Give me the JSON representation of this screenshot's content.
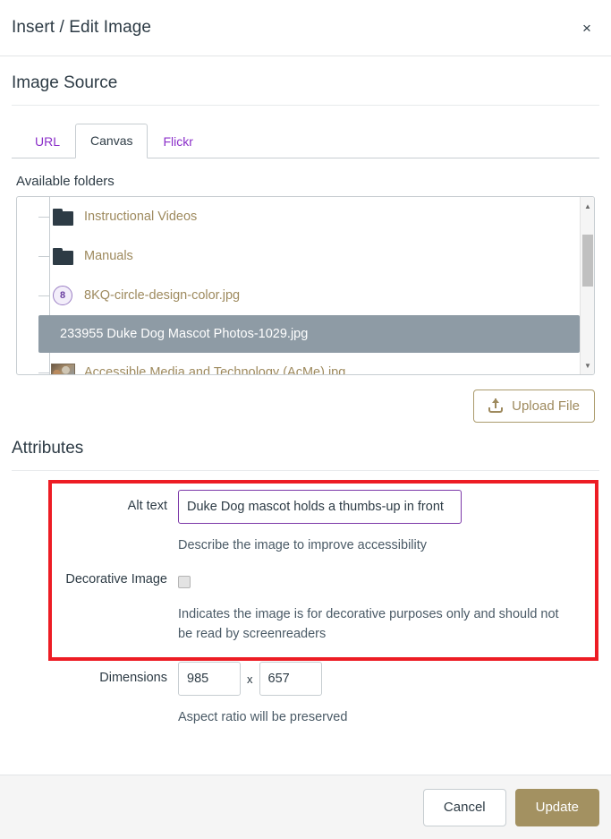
{
  "dialog": {
    "title": "Insert / Edit Image",
    "close_label": "×"
  },
  "image_source": {
    "heading": "Image Source",
    "tabs": [
      {
        "label": "URL",
        "active": false
      },
      {
        "label": "Canvas",
        "active": true
      },
      {
        "label": "Flickr",
        "active": false
      }
    ],
    "available_folders_label": "Available folders",
    "tree": [
      {
        "label": "Instructional Videos",
        "icon": "folder-icon",
        "selected": false
      },
      {
        "label": "Manuals",
        "icon": "folder-icon",
        "selected": false
      },
      {
        "label": "8KQ-circle-design-color.jpg",
        "icon": "circle-logo-thumbnail-icon",
        "selected": false
      },
      {
        "label": "233955 Duke Dog Mascot Photos-1029.jpg",
        "icon": "none",
        "selected": true
      },
      {
        "label": "Accessible Media and Technology (AcMe).jpg",
        "icon": "photo-thumbnail-icon",
        "selected": false
      }
    ],
    "upload_button_label": "Upload File",
    "upload_icon": "upload-arrow-icon"
  },
  "attributes": {
    "heading": "Attributes",
    "alt_text": {
      "label": "Alt text",
      "value": "Duke Dog mascot holds a thumbs-up in front",
      "placeholder": "",
      "help": "Describe the image to improve accessibility"
    },
    "decorative": {
      "label": "Decorative Image",
      "checked": false,
      "help": "Indicates the image is for decorative purposes only and should not be read by screenreaders"
    },
    "dimensions": {
      "label": "Dimensions",
      "width": "985",
      "separator": "x",
      "height": "657",
      "help": "Aspect ratio will be preserved"
    }
  },
  "footer": {
    "cancel_label": "Cancel",
    "update_label": "Update"
  },
  "annotation": {
    "highlight_color": "#ed1c24"
  },
  "colors": {
    "accent_gold": "#a39161",
    "link_purple": "#8b2fc9",
    "focus_purple": "#7b38a8",
    "selection_gray": "#8e9ba5",
    "text_dark": "#2d3b45"
  }
}
